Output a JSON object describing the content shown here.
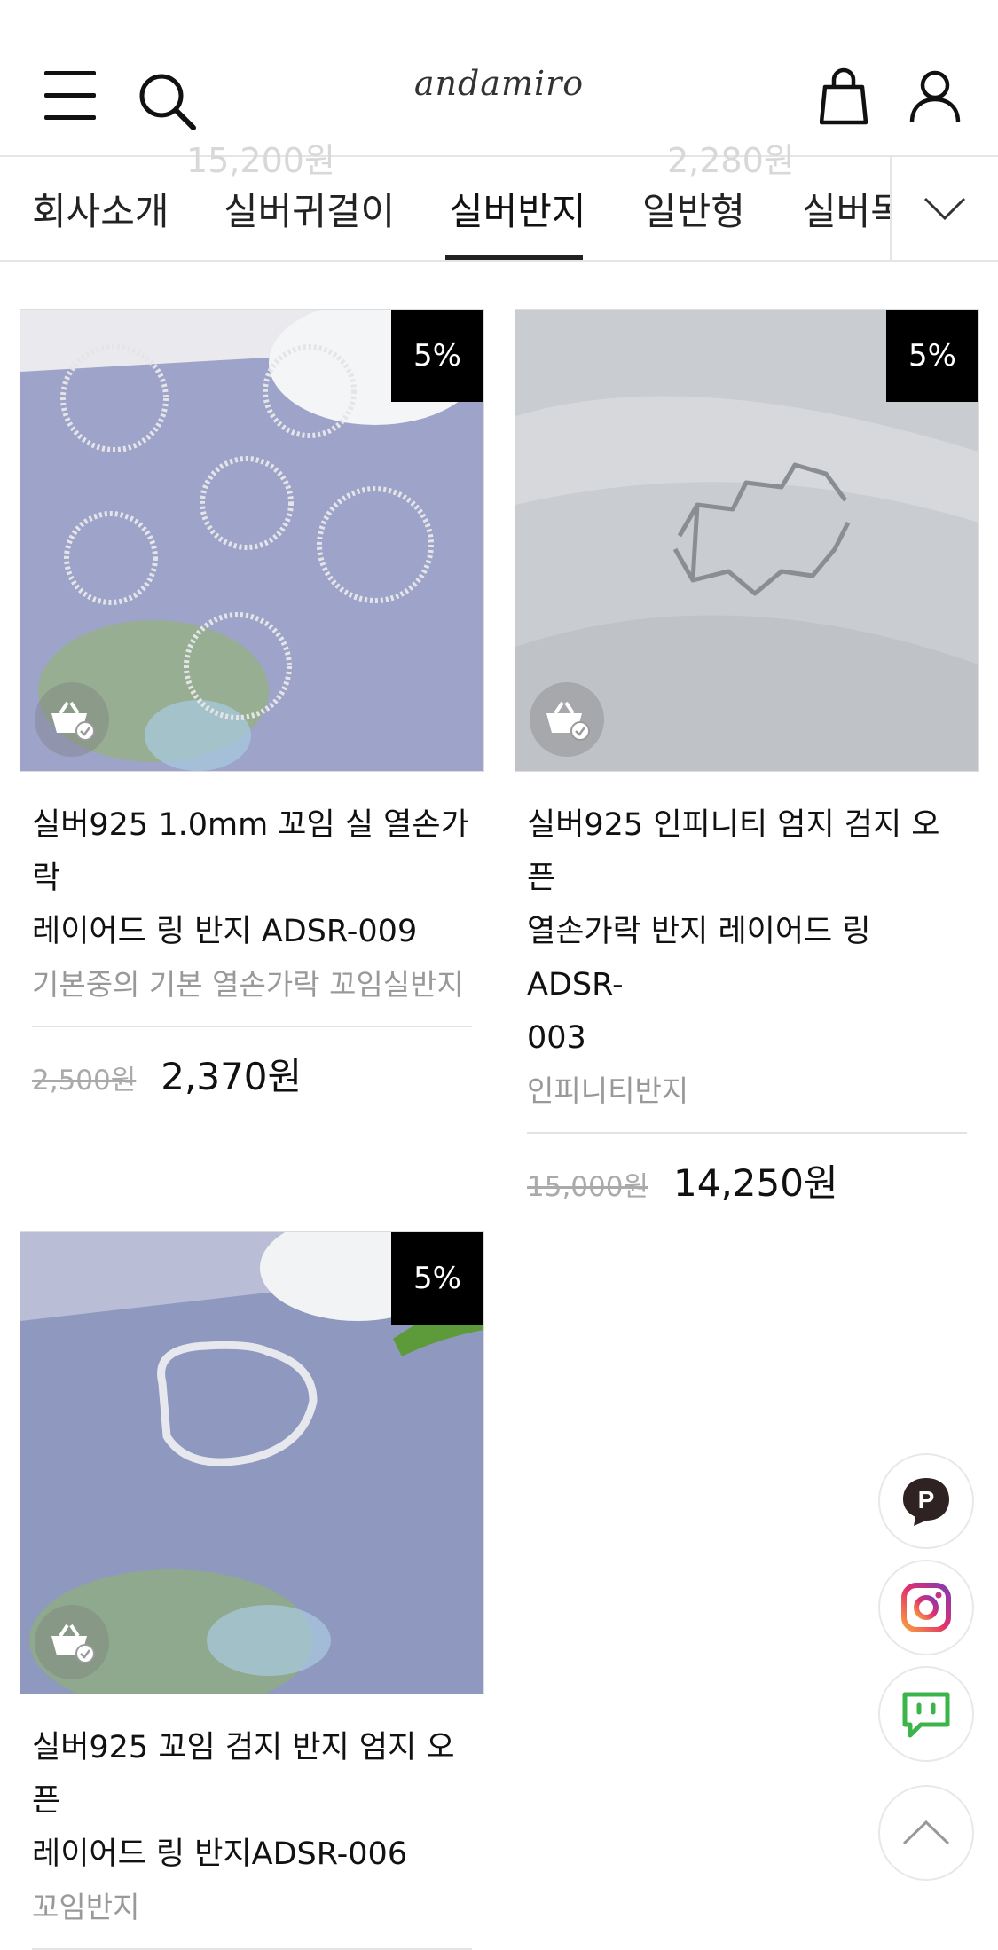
{
  "header": {
    "logo": "andamiro"
  },
  "ghost_prices": {
    "left": "15,200원",
    "right": "2,280원"
  },
  "tabs": [
    {
      "label": "회사소개"
    },
    {
      "label": "실버귀걸이"
    },
    {
      "label": "실버반지",
      "active": true
    },
    {
      "label": "일반형"
    },
    {
      "label": "실버목"
    }
  ],
  "products": [
    {
      "badge": "5%",
      "title_line1": "실버925 1.0mm 꼬임 실 열손가락",
      "title_line2": "레이어드 링 반지 ADSR-009",
      "subtitle": "기본중의 기본 열손가락 꼬임실반지",
      "original_price": "2,500원",
      "sale_price": "2,370원"
    },
    {
      "badge": "5%",
      "title_line1": "실버925 인피니티 엄지 검지 오픈",
      "title_line2": "열손가락 반지 레이어드 링 ADSR-",
      "title_line3": "003",
      "subtitle": "인피니티반지",
      "original_price": "15,000원",
      "sale_price": "14,250원"
    },
    {
      "badge": "5%",
      "title_line1": "실버925 꼬임 검지 반지 엄지 오픈",
      "title_line2": "레이어드 링 반지ADSR-006",
      "subtitle": "꼬임반지"
    }
  ],
  "floating": [
    "point-icon",
    "instagram-icon",
    "chat-icon",
    "scroll-top-icon"
  ]
}
